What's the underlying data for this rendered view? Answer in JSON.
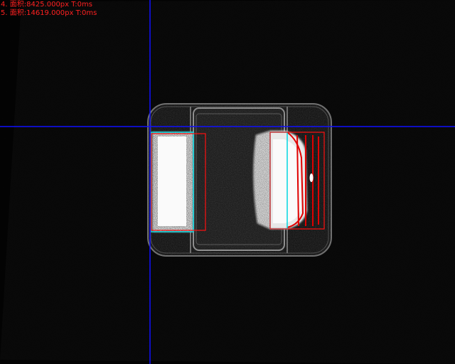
{
  "measurements": [
    {
      "text": "4. 面积:8425.000px  T:0ms"
    },
    {
      "text": "5. 面积:14619.000px  T:0ms"
    }
  ],
  "colors": {
    "background": "#040404",
    "field_tile": "#0b0b0b",
    "crosshair": "#1010ff",
    "roi_box": "#ff1010",
    "detected_region": "#00d6e0",
    "measurement_text": "#ff2020",
    "defect_marks": "#e00000",
    "electrode": "#f4f4f4",
    "component_body": "#242424",
    "component_outline": "#8a8a8a"
  },
  "icons": {
    "crosshair": "crosshair-icon"
  }
}
